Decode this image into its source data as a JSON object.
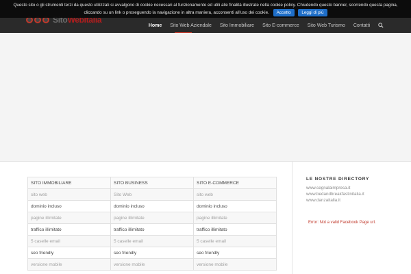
{
  "logo": {
    "text_grey": "Sito",
    "text_red": "WebItalia"
  },
  "nav": {
    "items": [
      "Home",
      "Sito Web Aziendale",
      "Sito Immobiliare",
      "Sito E-commerce",
      "Sito Web Turismo",
      "Contatti"
    ],
    "active": "Home",
    "search_icon": "search-icon"
  },
  "cookie_banner": {
    "text": "Questo sito o gli strumenti terzi da questo utilizzati si avvalgono di cookie necessari al funzionamento ed utili alle finalità illustrate nella cookie policy. Chiudendo questo banner, scorrendo questa pagina, cliccando su un link o proseguendo la navigazione in altra maniera, acconsenti all'uso dei cookie.",
    "accept_label": "Accetto",
    "more_label": "Leggi di più"
  },
  "table": {
    "headers": [
      "SITO IMMOBILIARE",
      "SITO BUSINESS",
      "SITO E-COMMERCE"
    ],
    "rows": [
      [
        "sito web",
        "Sito Web",
        "sito web"
      ],
      [
        "dominio incluso",
        "dominio incluso",
        "dominio incluso"
      ],
      [
        "pagine illimitate",
        "pagine illimitate",
        "pagine illimitate"
      ],
      [
        "traffico illimitato",
        "traffico illimitato",
        "traffico illimitato"
      ],
      [
        "5 caselle email",
        "5 caselle email",
        "5 caselle email"
      ],
      [
        "seo friendly",
        "seo friendly",
        "seo friendly"
      ],
      [
        "versione mobile",
        "versione mobile",
        "versione mobile"
      ]
    ]
  },
  "sidebar": {
    "title": "LE NOSTRE DIRECTORY",
    "links": [
      "www.segnalaimpresa.it",
      "www.bedandbreakfastinitalia.it",
      "www.danzaitalia.it"
    ],
    "fb_error": "Error: Not a valid Facebook Page url."
  }
}
